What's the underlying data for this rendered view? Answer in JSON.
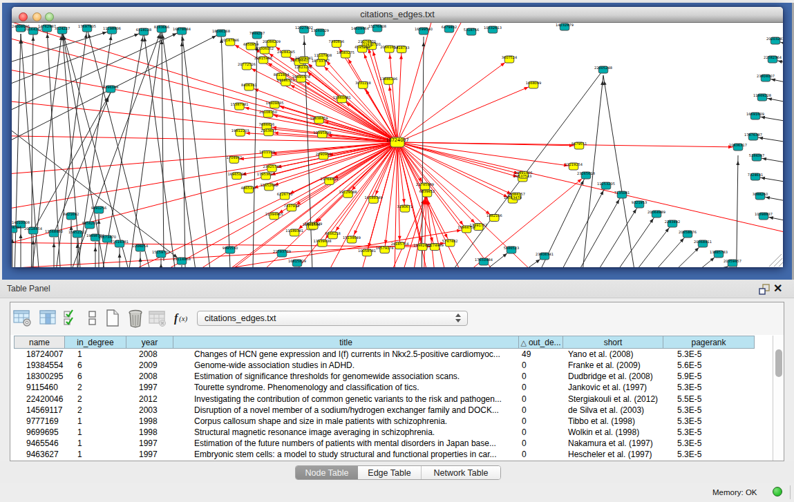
{
  "window": {
    "title": "citations_edges.txt"
  },
  "network": {
    "hub_label": "18724007",
    "colors": {
      "node_yellow": "#ffff00",
      "node_teal": "#00acad",
      "edge_red": "#ff0000",
      "edge_black": "#262626",
      "node_border": "#4a4a4a"
    }
  },
  "table_panel": {
    "title": "Table Panel",
    "toolbar_icons": [
      "table-settings",
      "show-columns",
      "select-columns",
      "rows",
      "new-document",
      "delete",
      "import-table-disabled",
      "function-builder"
    ],
    "table_dropdown_value": "citations_edges.txt",
    "sort_indicator": "△",
    "columns": [
      "name",
      "in_degree",
      "year",
      "title",
      "out_de...",
      "short",
      "pagerank"
    ],
    "rows": [
      [
        "18724007",
        "1",
        "2008",
        "Changes of HCN gene expression and I(f) currents in Nkx2.5-positive cardiomyoc...",
        "49",
        "Yano et al. (2008)",
        "5.3E-5"
      ],
      [
        "19384554",
        "6",
        "2009",
        "Genome-wide association studies in ADHD.",
        "0",
        "Franke et al. (2009)",
        "5.6E-5"
      ],
      [
        "18300295",
        "6",
        "2008",
        "Estimation of significance thresholds for genomewide association scans.",
        "0",
        "Dudbridge et al. (2008)",
        "5.9E-5"
      ],
      [
        "9115460",
        "2",
        "1997",
        "Tourette syndrome. Phenomenology and classification of tics.",
        "0",
        "Jankovic et al. (1997)",
        "5.3E-5"
      ],
      [
        "22420046",
        "2",
        "2012",
        "Investigating the contribution of common genetic variants to the risk and pathogen...",
        "0",
        "Stergiakouli et al. (2012)",
        "5.5E-5"
      ],
      [
        "14569117",
        "2",
        "2003",
        "Disruption of a novel member of a sodium/hydrogen exchanger family and DOCK...",
        "0",
        "de Silva et al. (2003)",
        "5.3E-5"
      ],
      [
        "9777169",
        "1",
        "1998",
        "Corpus callosum shape and size in male patients with schizophrenia.",
        "0",
        "Tibbo et al. (1998)",
        "5.3E-5"
      ],
      [
        "9699695",
        "1",
        "1998",
        "Structural magnetic resonance image averaging in schizophrenia.",
        "0",
        "Wolkin et al. (1998)",
        "5.3E-5"
      ],
      [
        "9465546",
        "1",
        "1997",
        "Estimation of the future numbers of patients with mental disorders in Japan base...",
        "0",
        "Nakamura et al. (1997)",
        "5.3E-5"
      ],
      [
        "9463627",
        "1",
        "1997",
        "Embryonic stem cells: a model to study structural and functional properties in car...",
        "0",
        "Hescheler et al. (1997)",
        "5.3E-5"
      ]
    ],
    "tabs": [
      "Node Table",
      "Edge Table",
      "Network Table"
    ],
    "active_tab": "Node Table"
  },
  "status_bar": {
    "memory_label": "Memory: OK"
  }
}
